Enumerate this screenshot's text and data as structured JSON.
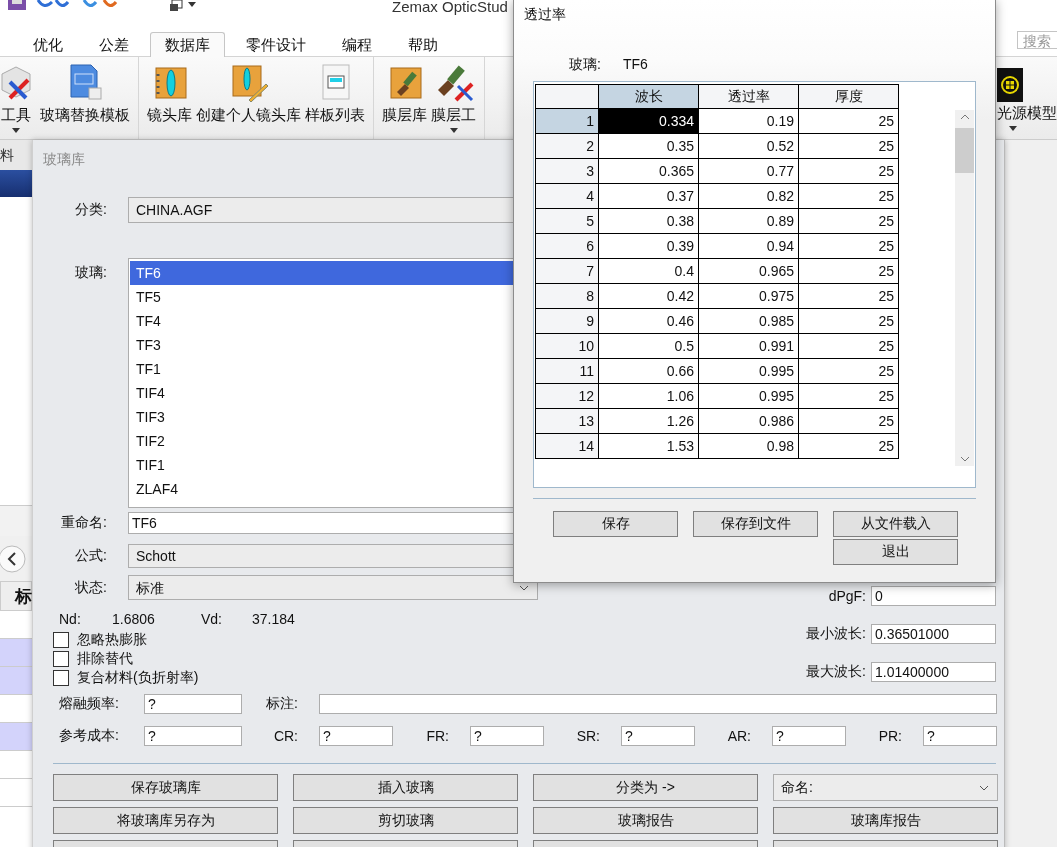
{
  "app": {
    "title": "Zemax OpticStud",
    "search": {
      "placeholder": "搜索"
    },
    "tabs": [
      {
        "label": "优化",
        "selected": false
      },
      {
        "label": "公差",
        "selected": false
      },
      {
        "label": "数据库",
        "selected": true
      },
      {
        "label": "零件设计",
        "selected": false
      },
      {
        "label": "编程",
        "selected": false
      },
      {
        "label": "帮助",
        "selected": false
      }
    ],
    "ribbon_groups": [
      {
        "items": [
          {
            "label": "工具",
            "menu": true
          },
          {
            "label": "玻璃替换模板",
            "menu": false
          }
        ]
      },
      {
        "items": [
          {
            "label": "镜头库",
            "menu": false
          },
          {
            "label": "创建个人镜头库",
            "menu": false
          },
          {
            "label": "样板列表",
            "menu": false
          }
        ]
      },
      {
        "items": [
          {
            "label": "膜层库",
            "menu": false
          },
          {
            "label": "膜层工",
            "menu": true
          }
        ]
      }
    ],
    "ribbon_right": {
      "label": "光源模型",
      "menu": true
    },
    "side_panel": {
      "tab": "料",
      "column": "标",
      "rows": [
        {
          "selected": false
        },
        {
          "selected": true
        },
        {
          "selected": true
        },
        {
          "selected": false
        },
        {
          "selected": true
        },
        {
          "selected": false
        },
        {
          "selected": false
        }
      ]
    }
  },
  "glass_library": {
    "title": "玻璃库",
    "category": {
      "label": "分类:",
      "value": "CHINA.AGF"
    },
    "glass_list": {
      "label": "玻璃:",
      "items": [
        {
          "name": "TF6",
          "selected": true
        },
        {
          "name": "TF5",
          "selected": false
        },
        {
          "name": "TF4",
          "selected": false
        },
        {
          "name": "TF3",
          "selected": false
        },
        {
          "name": "TF1",
          "selected": false
        },
        {
          "name": "TIF4",
          "selected": false
        },
        {
          "name": "TIF3",
          "selected": false
        },
        {
          "name": "TIF2",
          "selected": false
        },
        {
          "name": "TIF1",
          "selected": false
        },
        {
          "name": "ZLAF4",
          "selected": false
        }
      ]
    },
    "rename": {
      "label": "重命名:",
      "value": "TF6"
    },
    "formula": {
      "label": "公式:",
      "value": "Schott"
    },
    "status": {
      "label": "状态:",
      "value": "标准"
    },
    "nd": {
      "label": "Nd:",
      "value": "1.6806"
    },
    "vd": {
      "label": "Vd:",
      "value": "37.184"
    },
    "checkboxes": [
      {
        "label": "忽略热膨胀",
        "checked": false
      },
      {
        "label": "排除替代",
        "checked": false
      },
      {
        "label": "复合材料(负折射率)",
        "checked": false
      }
    ],
    "right_fields": [
      {
        "label": "dPgF:",
        "value": "0"
      },
      {
        "label": "最小波长:",
        "value": "0.36501000"
      },
      {
        "label": "最大波长:",
        "value": "1.01400000"
      }
    ],
    "melt_frequency": {
      "label": "熔融频率:",
      "value": "?"
    },
    "note": {
      "label": "标注:"
    },
    "cost_fields": [
      {
        "label": "参考成本:",
        "value": "?"
      },
      {
        "label": "CR:",
        "value": "?"
      },
      {
        "label": "FR:",
        "value": "?"
      },
      {
        "label": "SR:",
        "value": "?"
      },
      {
        "label": "AR:",
        "value": "?"
      },
      {
        "label": "PR:",
        "value": "?"
      }
    ],
    "actions": [
      {
        "kind": "button",
        "label": "保存玻璃库"
      },
      {
        "kind": "button",
        "label": "插入玻璃"
      },
      {
        "kind": "button",
        "label": "分类为 ->"
      },
      {
        "kind": "dropdown",
        "label": "命名:"
      },
      {
        "kind": "button",
        "label": "将玻璃库另存为"
      },
      {
        "kind": "button",
        "label": "剪切玻璃"
      },
      {
        "kind": "button",
        "label": "玻璃报告"
      },
      {
        "kind": "button",
        "label": "玻璃库报告"
      }
    ]
  },
  "transmission": {
    "title": "透过率",
    "glass_label": "玻璃:",
    "glass_value": "TF6",
    "columns": [
      {
        "label": "波长",
        "selected": true
      },
      {
        "label": "透过率",
        "selected": false
      },
      {
        "label": "厚度",
        "selected": false
      }
    ],
    "rows": [
      {
        "index": "1",
        "cells": [
          "0.334",
          "0.19",
          "25"
        ],
        "selected": true
      },
      {
        "index": "2",
        "cells": [
          "0.35",
          "0.52",
          "25"
        ],
        "selected": false
      },
      {
        "index": "3",
        "cells": [
          "0.365",
          "0.77",
          "25"
        ],
        "selected": false
      },
      {
        "index": "4",
        "cells": [
          "0.37",
          "0.82",
          "25"
        ],
        "selected": false
      },
      {
        "index": "5",
        "cells": [
          "0.38",
          "0.89",
          "25"
        ],
        "selected": false
      },
      {
        "index": "6",
        "cells": [
          "0.39",
          "0.94",
          "25"
        ],
        "selected": false
      },
      {
        "index": "7",
        "cells": [
          "0.4",
          "0.965",
          "25"
        ],
        "selected": false
      },
      {
        "index": "8",
        "cells": [
          "0.42",
          "0.975",
          "25"
        ],
        "selected": false
      },
      {
        "index": "9",
        "cells": [
          "0.46",
          "0.985",
          "25"
        ],
        "selected": false
      },
      {
        "index": "10",
        "cells": [
          "0.5",
          "0.991",
          "25"
        ],
        "selected": false
      },
      {
        "index": "11",
        "cells": [
          "0.66",
          "0.995",
          "25"
        ],
        "selected": false
      },
      {
        "index": "12",
        "cells": [
          "1.06",
          "0.995",
          "25"
        ],
        "selected": false
      },
      {
        "index": "13",
        "cells": [
          "1.26",
          "0.986",
          "25"
        ],
        "selected": false
      },
      {
        "index": "14",
        "cells": [
          "1.53",
          "0.98",
          "25"
        ],
        "selected": false
      }
    ],
    "buttons": [
      {
        "label": "保存",
        "kind": "button"
      },
      {
        "label": "保存到文件",
        "kind": "button"
      },
      {
        "label": "从文件载入",
        "kind": "button"
      },
      {
        "label": "退出",
        "kind": "button"
      }
    ]
  }
}
